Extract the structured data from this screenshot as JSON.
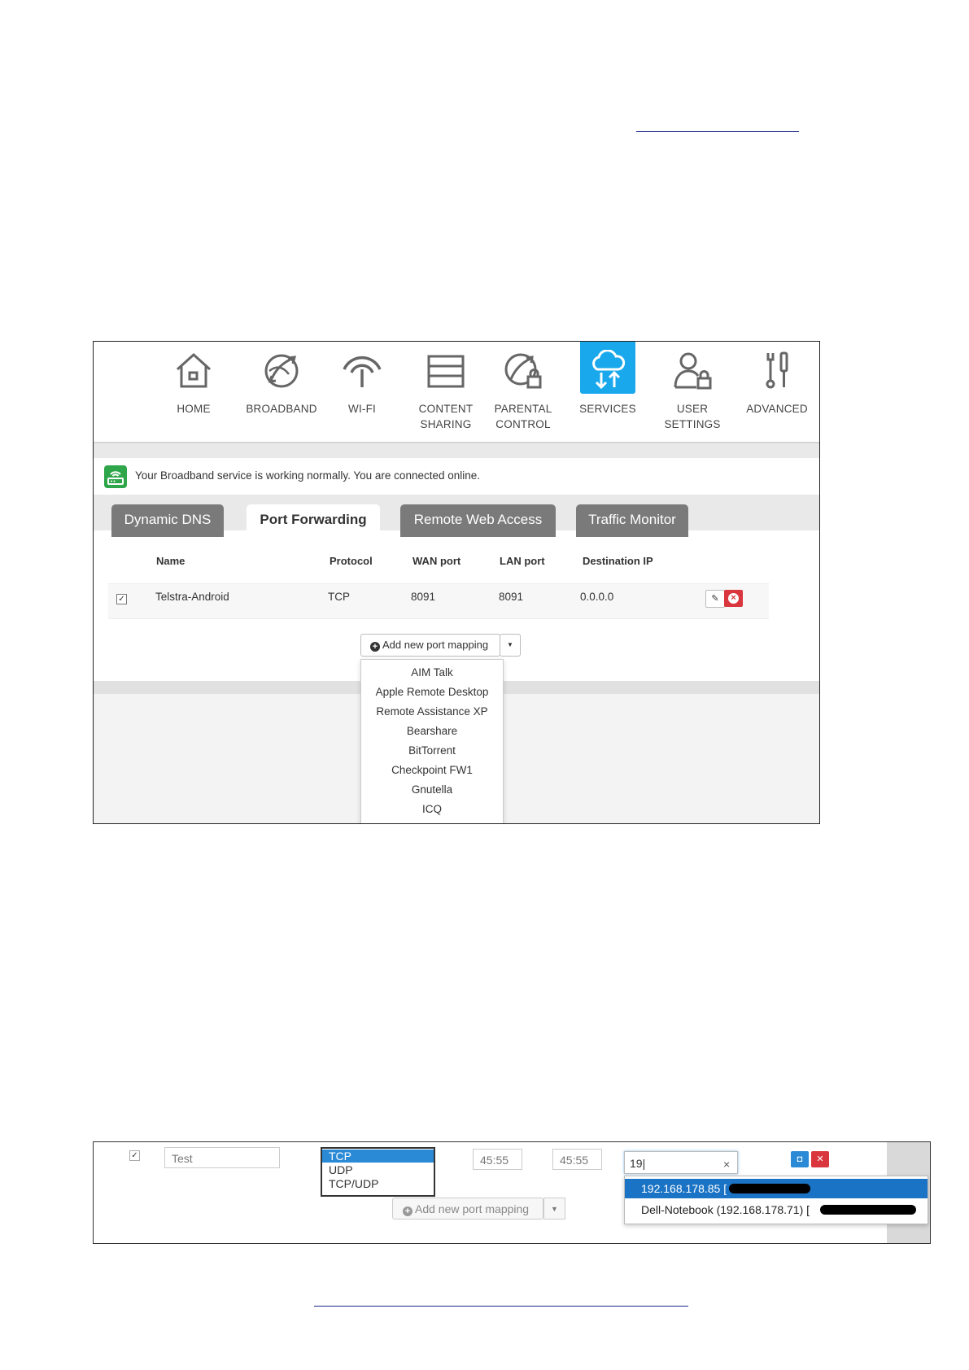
{
  "nav": {
    "items": [
      {
        "label": "HOME",
        "icon": "home-icon"
      },
      {
        "label": "BROADBAND",
        "icon": "globe-icon"
      },
      {
        "label": "WI-FI",
        "icon": "wifi-icon"
      },
      {
        "label": "CONTENT\nSHARING",
        "icon": "storage-icon"
      },
      {
        "label": "PARENTAL\nCONTROL",
        "icon": "parental-lock-icon"
      },
      {
        "label": "SERVICES",
        "icon": "cloud-transfer-icon",
        "active": true
      },
      {
        "label": "USER\nSETTINGS",
        "icon": "user-lock-icon"
      },
      {
        "label": "ADVANCED",
        "icon": "tools-icon"
      }
    ]
  },
  "status": {
    "message": "Your Broadband service is working normally. You are connected online."
  },
  "tabs": [
    {
      "label": "Dynamic DNS"
    },
    {
      "label": "Port Forwarding",
      "active": true
    },
    {
      "label": "Remote Web Access"
    },
    {
      "label": "Traffic Monitor"
    }
  ],
  "table": {
    "headers": [
      "Name",
      "Protocol",
      "WAN port",
      "LAN port",
      "Destination IP"
    ],
    "rows": [
      {
        "checked": true,
        "name": "Telstra-Android",
        "protocol": "TCP",
        "wan_port": "8091",
        "lan_port": "8091",
        "destination_ip": "0.0.0.0"
      }
    ]
  },
  "add_button": {
    "label": "Add new port mapping"
  },
  "presets": [
    "AIM Talk",
    "Apple Remote Desktop",
    "Remote Assistance XP",
    "Bearshare",
    "BitTorrent",
    "Checkpoint FW1",
    "Gnutella",
    "ICQ"
  ],
  "edit_row": {
    "name_value": "Test",
    "protocol_options": [
      "TCP",
      "UDP",
      "TCP/UDP"
    ],
    "protocol_selected": "TCP",
    "wan_port": "45:55",
    "lan_port": "45:55",
    "ip_query": "19",
    "ip_suggestions": [
      {
        "text": "192.168.178.85 [",
        "highlighted": true
      },
      {
        "text": "Dell-Notebook (192.168.178.71) [",
        "highlighted": false
      }
    ],
    "add_button_label": "Add new port mapping"
  },
  "colors": {
    "active_tile": "#19a8ec",
    "tab_inactive": "#7a7a7a",
    "status_icon": "#2fa64a",
    "delete": "#d9363e",
    "save": "#2a8ad6"
  }
}
